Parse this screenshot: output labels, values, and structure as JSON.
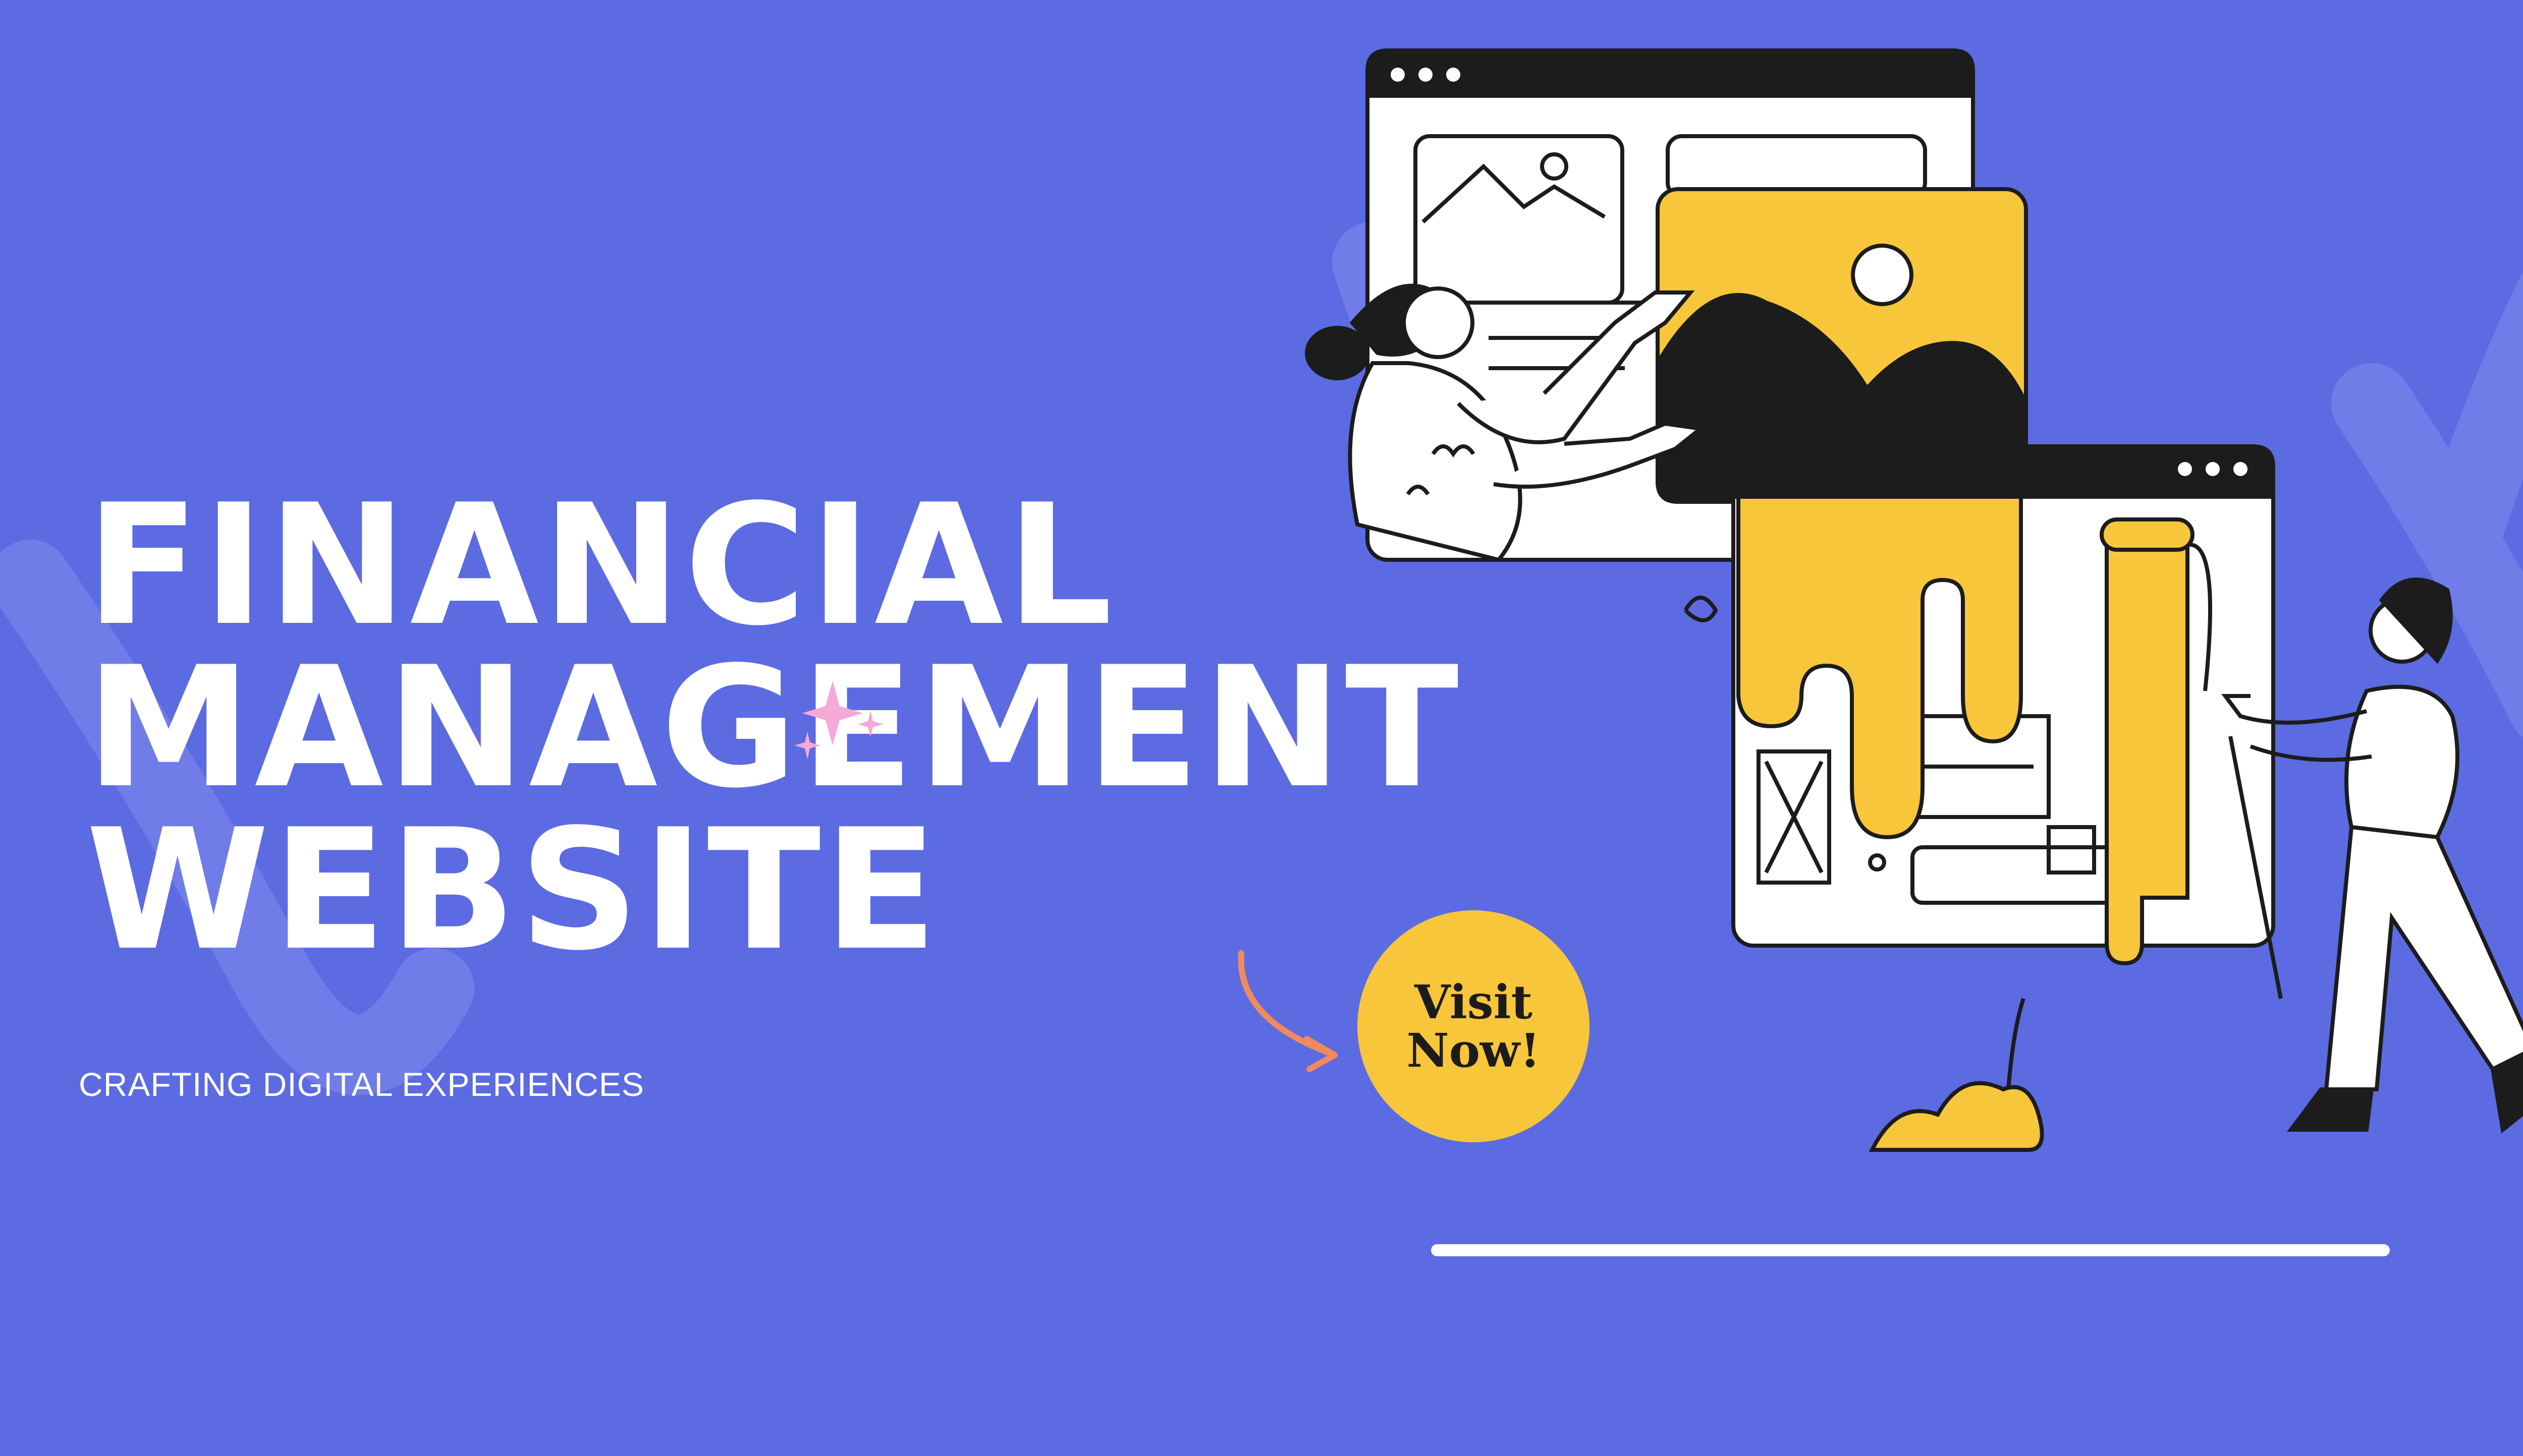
{
  "banner": {
    "headline": [
      "FINANCIAL",
      "MANAGEMENT",
      "WEBSITE"
    ],
    "tagline": "CRAFTING DIGITAL EXPERIENCES",
    "cta": [
      "Visit",
      "Now!"
    ]
  },
  "icons": {
    "sparkle": "sparkle-icon",
    "arrow": "curved-arrow-icon"
  },
  "colors": {
    "background": "#5c6be2",
    "accent_yellow": "#f8c63b",
    "ink": "#1c1c1c",
    "white": "#ffffff",
    "arrow": "#f08a5d",
    "sparkle": "#f4a9d6"
  }
}
